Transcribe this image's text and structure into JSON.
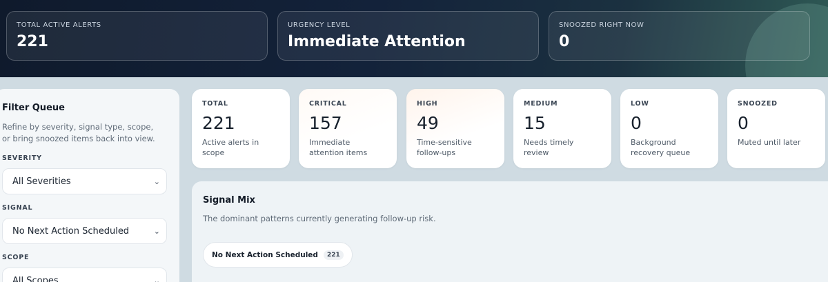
{
  "summary": [
    {
      "label": "TOTAL ACTIVE ALERTS",
      "value": "221"
    },
    {
      "label": "URGENCY LEVEL",
      "value": "Immediate Attention"
    },
    {
      "label": "SNOOZED RIGHT NOW",
      "value": "0"
    }
  ],
  "filter": {
    "title": "Filter Queue",
    "description": "Refine by severity, signal type, scope, or bring snoozed items back into view.",
    "severity_label": "SEVERITY",
    "severity_value": "All Severities",
    "signal_label": "SIGNAL",
    "signal_value": "No Next Action Scheduled",
    "scope_label": "SCOPE",
    "scope_value": "All Scopes"
  },
  "severity_cards": [
    {
      "key": "TOTAL",
      "count": "221",
      "desc": "Active alerts in scope"
    },
    {
      "key": "CRITICAL",
      "count": "157",
      "desc": "Immediate attention items"
    },
    {
      "key": "HIGH",
      "count": "49",
      "desc": "Time-sensitive follow-ups"
    },
    {
      "key": "MEDIUM",
      "count": "15",
      "desc": "Needs timely review"
    },
    {
      "key": "LOW",
      "count": "0",
      "desc": "Background recovery queue"
    },
    {
      "key": "SNOOZED",
      "count": "0",
      "desc": "Muted until later"
    }
  ],
  "signal_mix": {
    "title": "Signal Mix",
    "subtitle": "The dominant patterns currently generating follow-up risk.",
    "pills": [
      {
        "label": "No Next Action Scheduled",
        "count": "221"
      }
    ]
  },
  "icons": {
    "select_chevron": "chevron-down-icon"
  },
  "colors": {
    "hero_dark": "#0f1a2c",
    "hero_teal": "#2f5a55",
    "page_bg": "#cfdbe2"
  }
}
